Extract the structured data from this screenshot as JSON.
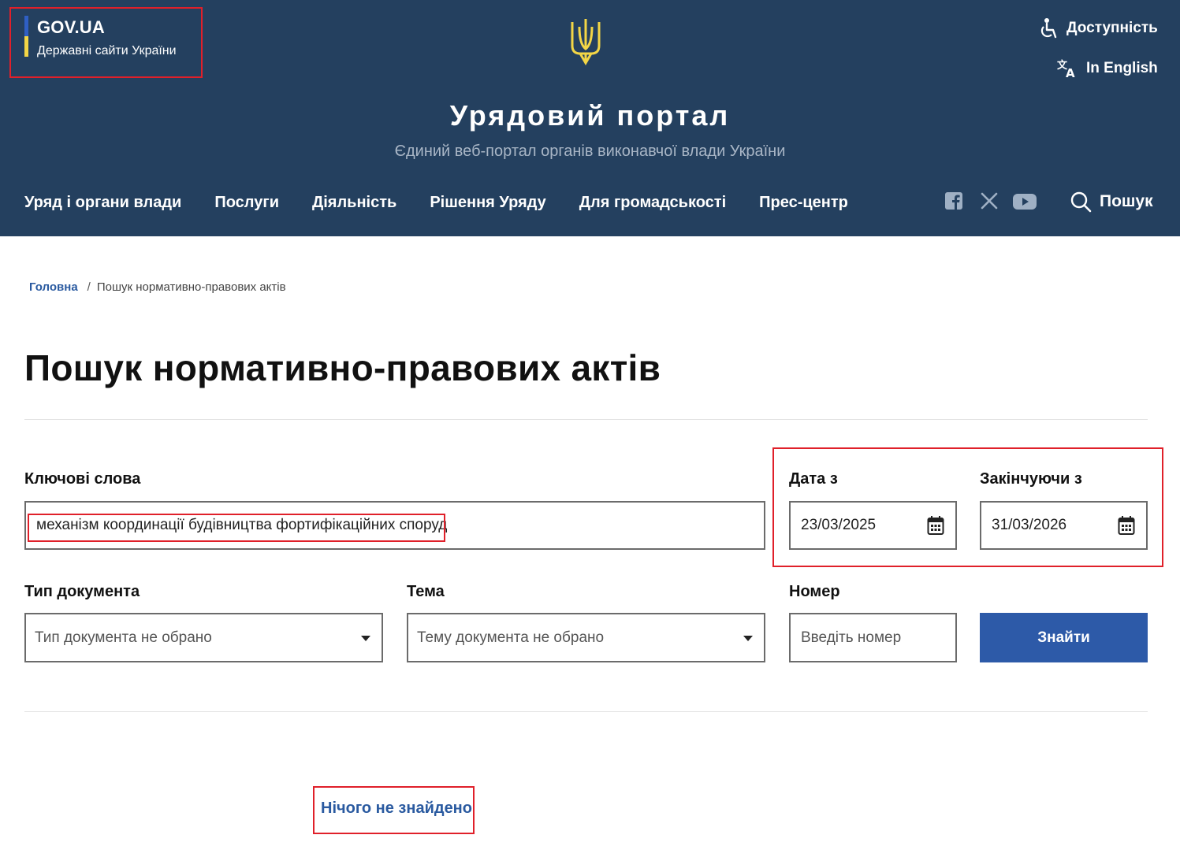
{
  "header": {
    "gov_title": "GOV.UA",
    "gov_subtitle": "Державні сайти України",
    "accessibility_label": "Доступність",
    "language_label": "In English",
    "portal_title": "Урядовий портал",
    "portal_subtitle": "Єдиний веб-портал органів виконавчої влади України",
    "nav": [
      {
        "label": "Уряд і органи влади"
      },
      {
        "label": "Послуги"
      },
      {
        "label": "Діяльність"
      },
      {
        "label": "Рішення Уряду"
      },
      {
        "label": "Для громадськості"
      },
      {
        "label": "Прес-центр"
      }
    ],
    "social_icons": [
      "facebook-icon",
      "x-icon",
      "youtube-icon"
    ],
    "search_label": "Пошук"
  },
  "breadcrumb": {
    "home": "Головна",
    "separator": "/",
    "current": "Пошук нормативно-правових актів"
  },
  "page": {
    "title": "Пошук нормативно-правових актів"
  },
  "form": {
    "keywords": {
      "label": "Ключові слова",
      "value": "механізм координації будівництва фортифікаційних споруд"
    },
    "date_from": {
      "label": "Дата з",
      "value": "23/03/2025"
    },
    "date_to": {
      "label": "Закінчуючи з",
      "value": "31/03/2026"
    },
    "doc_type": {
      "label": "Тип документа",
      "value": "Тип документа не обрано"
    },
    "topic": {
      "label": "Тема",
      "value": "Тему документа не обрано"
    },
    "number": {
      "label": "Номер",
      "placeholder": "Введіть номер"
    },
    "submit_label": "Знайти"
  },
  "results": {
    "message": "Нічого не знайдено"
  },
  "colors": {
    "header_bg": "#24405f",
    "accent_blue": "#2d5aa8",
    "link_blue": "#2a5aa0",
    "flag_blue": "#2f5fc4",
    "flag_yellow": "#f3d646",
    "annotation_red": "#e0202a"
  }
}
